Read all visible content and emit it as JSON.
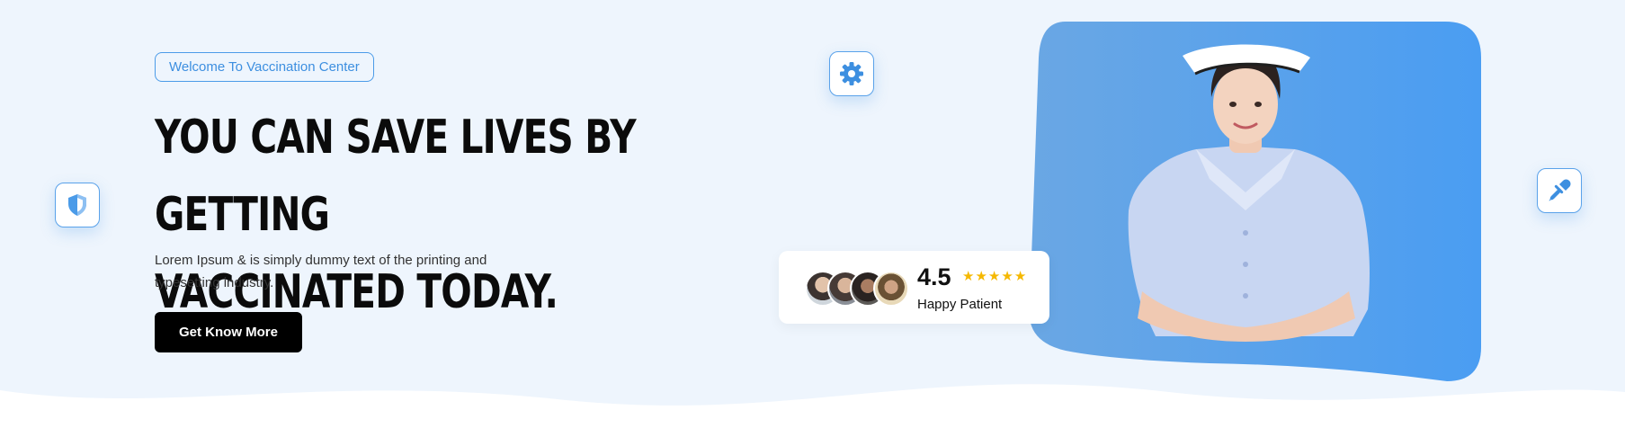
{
  "hero": {
    "badge": "Welcome To Vaccination Center",
    "headline_line1": "You Can Save Lives By Getting",
    "headline_line2": "Vaccinated Today.",
    "description": "Lorem Ipsum & is simply dummy text of the printing and typesetting industry.",
    "cta_label": "Get Know More"
  },
  "rating": {
    "value": "4.5",
    "stars": 5,
    "label": "Happy Patient"
  },
  "icons": {
    "left": "shield-icon",
    "top": "gear-icon",
    "right": "pipette-icon"
  },
  "colors": {
    "accent": "#4b9be8",
    "background": "#eef5fd",
    "button": "#000000",
    "star": "#f5b800",
    "photo_bg": "#4b9cef"
  }
}
